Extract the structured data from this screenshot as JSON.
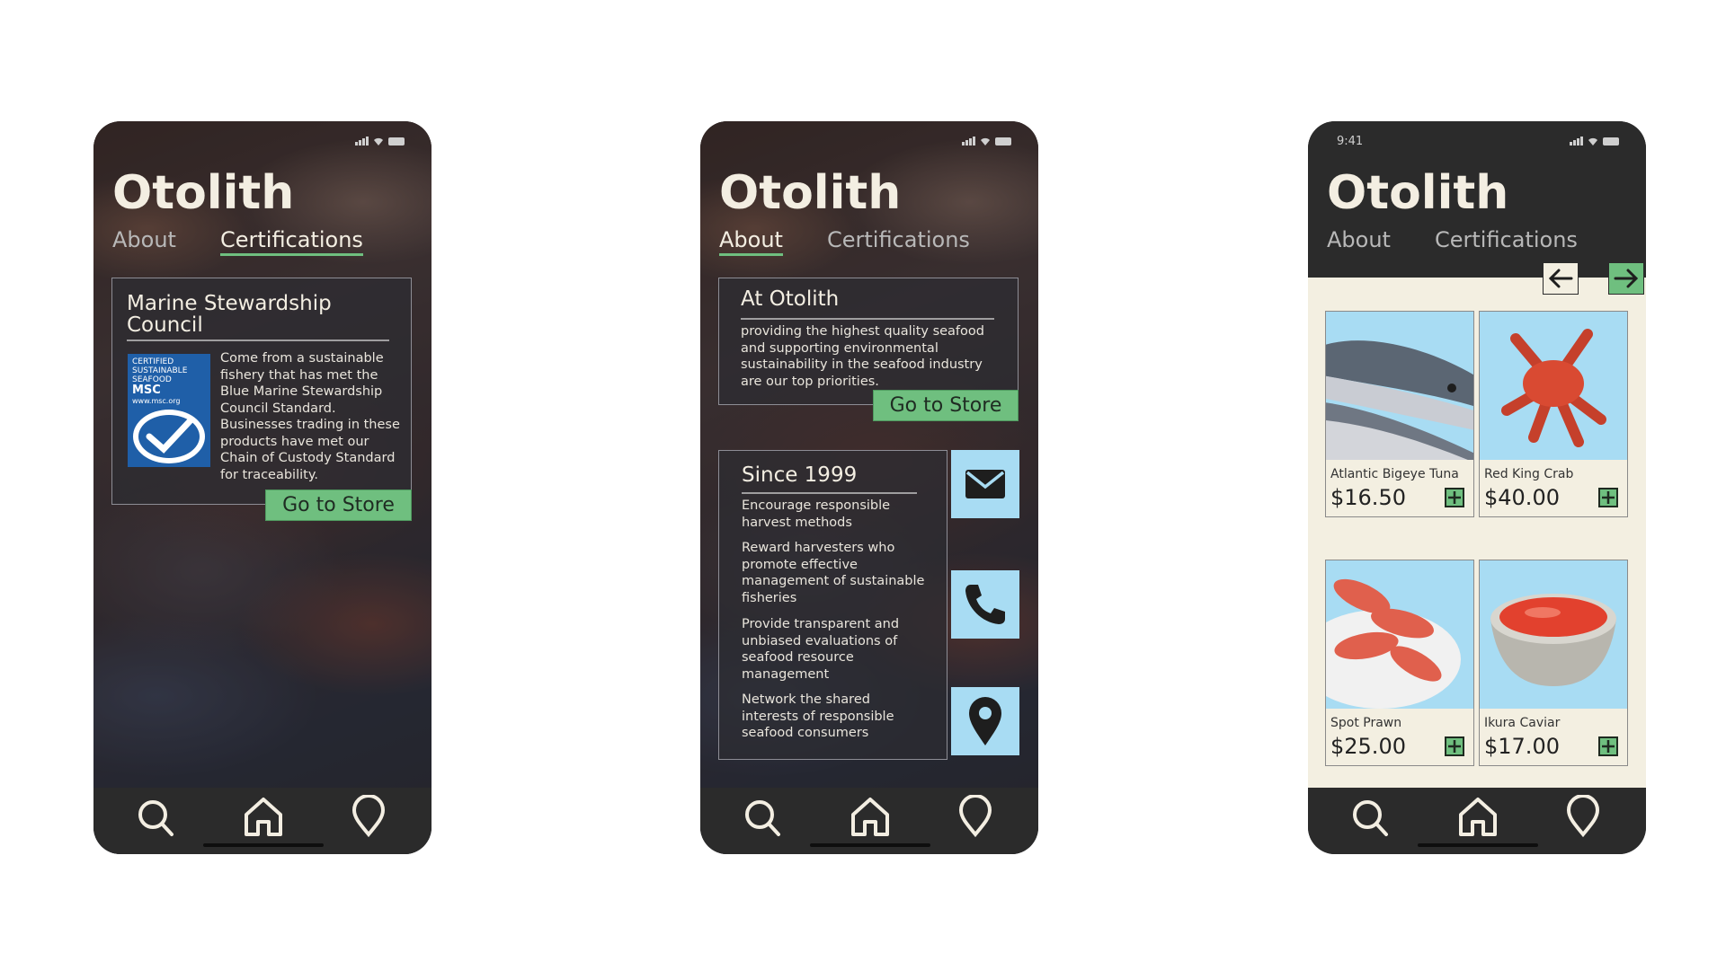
{
  "status_time": "9:41",
  "brand": "Otolith",
  "tabs": {
    "about": "About",
    "certifications": "Certifications"
  },
  "screen_certifications": {
    "title": "Marine Stewardship Council",
    "msc_logo_lines": [
      "CERTIFIED",
      "SUSTAINABLE",
      "SEAFOOD",
      "MSC",
      "www.msc.org"
    ],
    "body": "Come from a sustainable fishery that has met the Blue Marine Stewardship Council Standard. Businesses trading in these products have met our Chain of Custody Standard for traceability.",
    "store_button": "Go to Store"
  },
  "screen_about": {
    "intro_title": "At Otolith",
    "intro_body": "providing the highest quality seafood and supporting environmental sustainability in the seafood industry are our top priorities.",
    "store_button": "Go to Store",
    "since_title": "Since 1999",
    "goals": [
      "Encourage responsible harvest methods",
      "Reward harvesters who promote effective management of sustainable fisheries",
      "Provide transparent and unbiased evaluations of seafood resource management",
      "Network the shared interests of responsible seafood consumers"
    ],
    "contact_icons": [
      "mail-icon",
      "phone-icon",
      "location-icon"
    ]
  },
  "screen_store": {
    "products": [
      {
        "name": "Atlantic Bigeye Tuna",
        "price": "$16.50"
      },
      {
        "name": "Red King Crab",
        "price": "$40.00"
      },
      {
        "name": "Spot Prawn",
        "price": "$25.00"
      },
      {
        "name": "Ikura Caviar",
        "price": "$17.00"
      }
    ]
  },
  "nav_icons": [
    "search-icon",
    "home-icon",
    "location-pin-icon"
  ],
  "colors": {
    "accent_green": "#6fbf7f",
    "dark": "#2b2b2b",
    "cream": "#f3efe1",
    "sky": "#a8dcf3",
    "msc_blue": "#1f5fa8"
  }
}
